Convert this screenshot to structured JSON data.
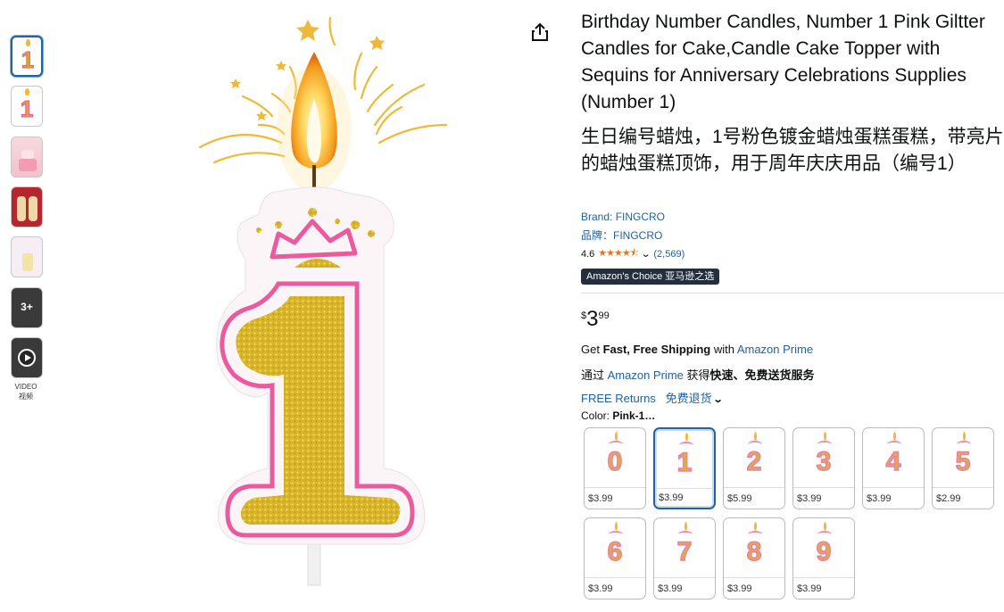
{
  "thumbnails": {
    "more_label": "3+",
    "video_label_en": "VIDEO",
    "video_label_zh": "视频"
  },
  "product": {
    "title": "Birthday Number Candles, Number 1 Pink Giltter Candles for Cake,Candle Cake Topper with Sequins for Anniversary Celebrations Supplies (Number 1)",
    "title_zh": "生日编号蜡烛，1号粉色镀金蜡烛蛋糕蛋糕，带亮片的蜡烛蛋糕顶饰，用于周年庆庆用品（编号1）",
    "brand_en": "Brand: FINGCRO",
    "brand_zh": "品牌：FINGCRO",
    "rating_value": "4.6",
    "rating_stars": "★★★★⯪",
    "rating_count": "(2,569)",
    "badge": "Amazon's Choice  亚马逊之选",
    "price_symbol": "$",
    "price_whole": "3",
    "price_fraction": "99"
  },
  "shipping": {
    "get": "Get ",
    "fast_free": "Fast, Free Shipping",
    "with": " with ",
    "prime": "Amazon Prime",
    "zh_prefix": "通过 ",
    "zh_prime": "Amazon Prime",
    "zh_get": " 获得",
    "zh_bold": "快速、免费送货服务",
    "returns_en": "FREE Returns",
    "returns_zh": "免费退货"
  },
  "color": {
    "label": "Color: ",
    "selected": "Pink-1…"
  },
  "swatches": [
    {
      "digit": "0",
      "price": "$3.99"
    },
    {
      "digit": "1",
      "price": "$3.99"
    },
    {
      "digit": "2",
      "price": "$5.99"
    },
    {
      "digit": "3",
      "price": "$3.99"
    },
    {
      "digit": "4",
      "price": "$3.99"
    },
    {
      "digit": "5",
      "price": "$2.99"
    },
    {
      "digit": "6",
      "price": "$3.99"
    },
    {
      "digit": "7",
      "price": "$3.99"
    },
    {
      "digit": "8",
      "price": "$3.99"
    },
    {
      "digit": "9",
      "price": "$3.99"
    }
  ],
  "selected_swatch_index": 1,
  "colors": {
    "link": "#2162a1",
    "star": "#de7921",
    "badge_bg": "#232f3e",
    "candle_gold": "#e0ae3c",
    "candle_pink": "#ea5a9c"
  }
}
